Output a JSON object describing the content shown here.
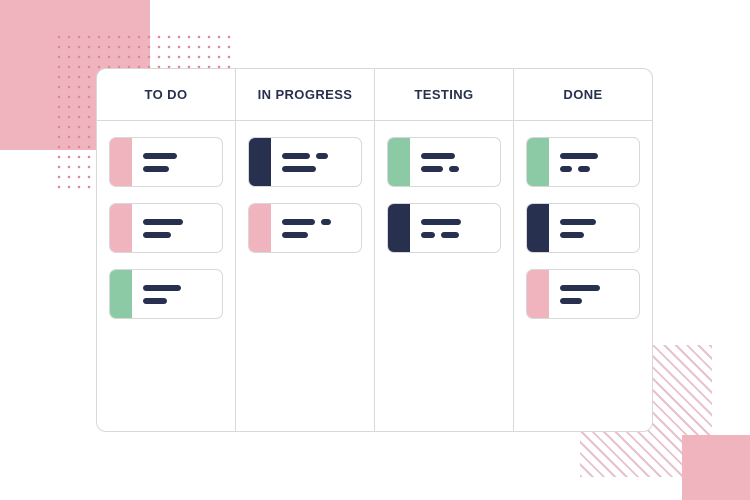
{
  "board": {
    "columns": [
      {
        "id": "todo",
        "title": "TO DO",
        "cards": [
          {
            "accent": "pink",
            "rows": [
              [
                34
              ],
              [
                26
              ]
            ]
          },
          {
            "accent": "pink",
            "rows": [
              [
                40
              ],
              [
                28
              ]
            ]
          },
          {
            "accent": "green",
            "rows": [
              [
                38
              ],
              [
                24
              ]
            ]
          }
        ]
      },
      {
        "id": "in-progress",
        "title": "IN PROGRESS",
        "cards": [
          {
            "accent": "navy",
            "rows": [
              [
                28,
                12
              ],
              [
                34
              ]
            ]
          },
          {
            "accent": "pink",
            "rows": [
              [
                33,
                10
              ],
              [
                26
              ]
            ]
          }
        ]
      },
      {
        "id": "testing",
        "title": "TESTING",
        "cards": [
          {
            "accent": "green",
            "rows": [
              [
                34
              ],
              [
                22,
                10
              ]
            ]
          },
          {
            "accent": "navy",
            "rows": [
              [
                40
              ],
              [
                14,
                18
              ]
            ]
          }
        ]
      },
      {
        "id": "done",
        "title": "DONE",
        "cards": [
          {
            "accent": "green",
            "rows": [
              [
                38
              ],
              [
                12,
                12
              ]
            ]
          },
          {
            "accent": "navy",
            "rows": [
              [
                36
              ],
              [
                24
              ]
            ]
          },
          {
            "accent": "pink",
            "rows": [
              [
                40
              ],
              [
                22
              ]
            ]
          }
        ]
      }
    ]
  },
  "decor": {
    "pink_square_top_left": "#f0b4bf",
    "dot_grid_top_left": "#d98a9c",
    "stripes_bottom_right": "#e7c2cd",
    "pink_square_bottom_right": "#f0b4bf"
  },
  "colors": {
    "accent_pink": "#f0b4bf",
    "accent_green": "#8bcaa5",
    "accent_navy": "#27314f",
    "border": "#d8d8d8",
    "text": "#27314f",
    "background": "#ffffff"
  }
}
